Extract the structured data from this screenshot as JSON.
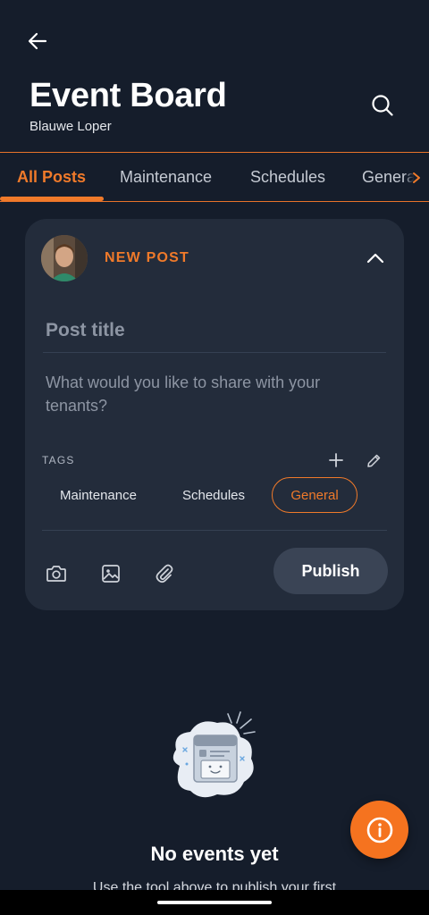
{
  "header": {
    "title": "Event Board",
    "subtitle": "Blauwe Loper",
    "back_icon": "arrow-left-icon",
    "search_icon": "search-icon"
  },
  "tabs": [
    {
      "label": "All Posts",
      "active": true
    },
    {
      "label": "Maintenance",
      "active": false
    },
    {
      "label": "Schedules",
      "active": false
    },
    {
      "label": "General",
      "active": false
    }
  ],
  "composer": {
    "label": "NEW POST",
    "title_placeholder": "Post title",
    "body_placeholder": "What would you like to share with your tenants?",
    "tags_label": "TAGS",
    "tags": [
      {
        "label": "Maintenance",
        "selected": false
      },
      {
        "label": "Schedules",
        "selected": false
      },
      {
        "label": "General",
        "selected": true
      }
    ],
    "publish_label": "Publish"
  },
  "empty_state": {
    "title": "No events yet",
    "subtitle": "Use the tool above to publish your first"
  },
  "colors": {
    "accent": "#f07a2a",
    "background": "#151d2b",
    "card": "#232c3b",
    "fab": "#f5731f"
  }
}
